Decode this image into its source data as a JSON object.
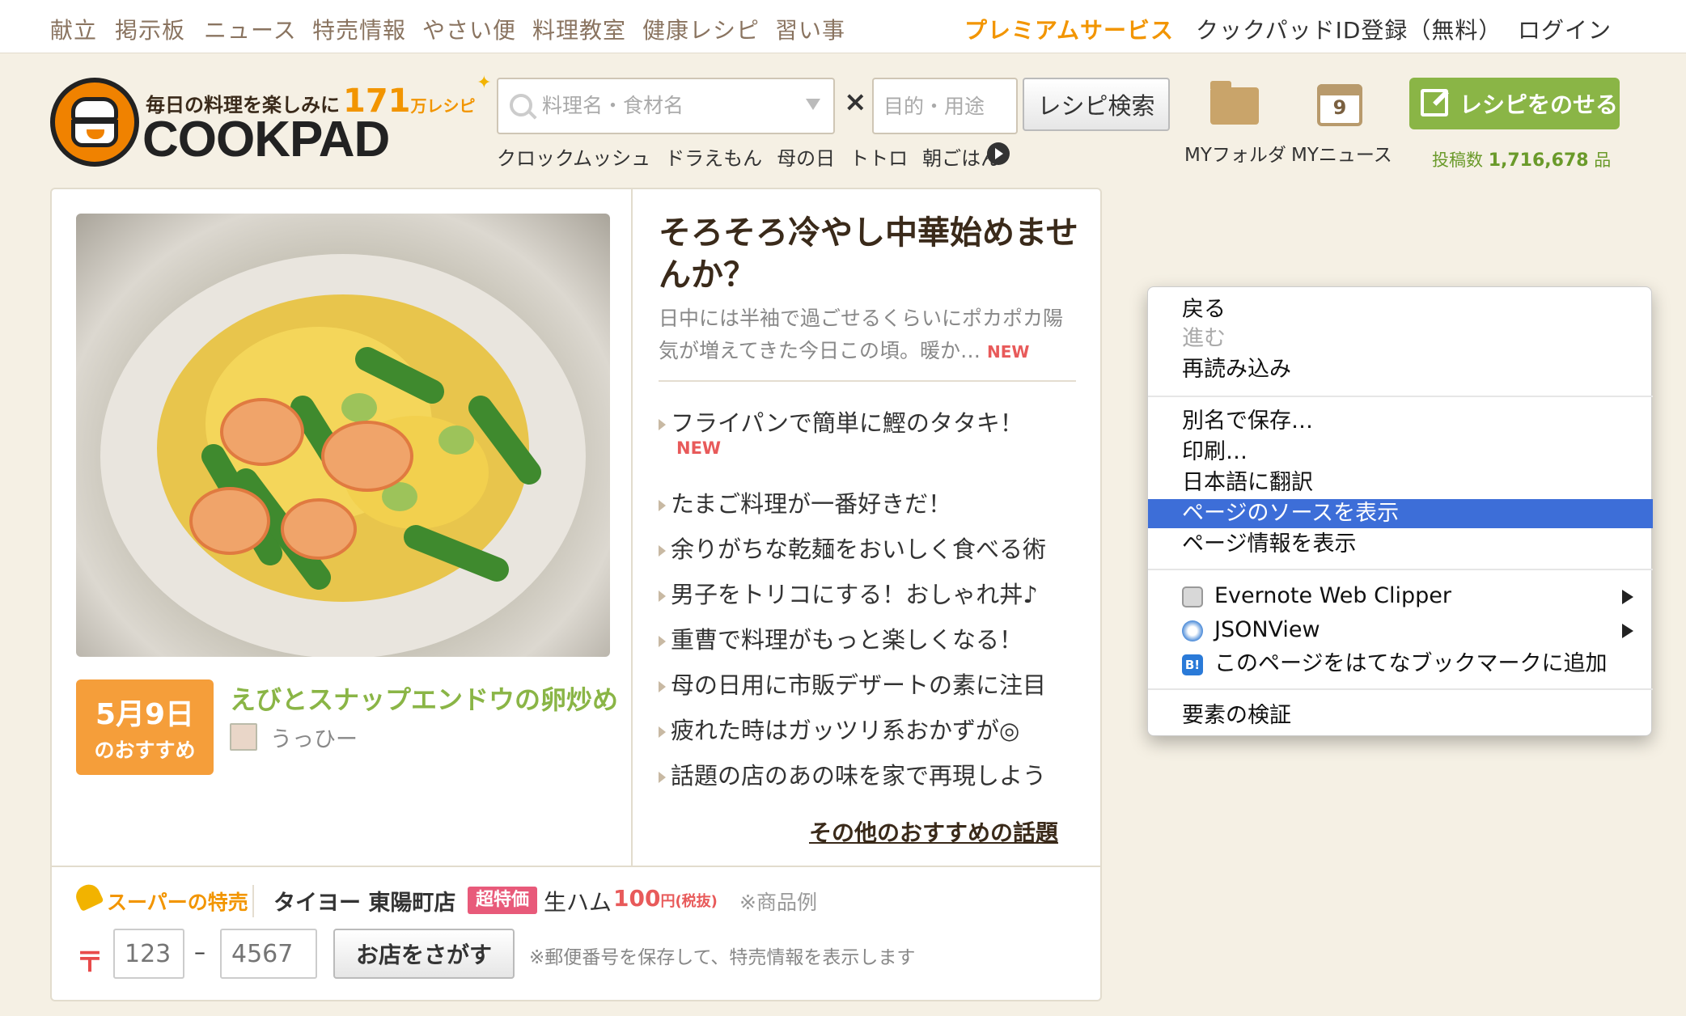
{
  "topnav": {
    "items": [
      "献立",
      "掲示板",
      "ニュース",
      "特売情報",
      "やさい便",
      "料理教室",
      "健康レシピ",
      "習い事"
    ],
    "premium": "プレミアムサービス",
    "register": "クックパッドID登録（無料）",
    "login": "ログイン"
  },
  "logo": {
    "tagline": "毎日の料理を楽しみに",
    "count": "171",
    "unit": "万レシピ",
    "wordmark": "COOKPAD"
  },
  "search": {
    "keyword_placeholder": "料理名・食材名",
    "purpose_placeholder": "目的・用途",
    "button": "レシピ検索",
    "suggestions": [
      "クロックムッシュ",
      "ドラえもん",
      "母の日",
      "トトロ",
      "朝ごはん"
    ]
  },
  "header_icons": {
    "folder_label": "MYフォルダ",
    "news_label": "MYニュース",
    "calendar_day": "9"
  },
  "post": {
    "button": "レシピをのせる",
    "count_prefix": "投稿数",
    "count_value": "1,716,678",
    "count_unit": "品"
  },
  "featured_recipe": {
    "date_line1": "5月9日",
    "date_line2": "のおすすめ",
    "title": "えびとスナップエンドウの卵炒め",
    "author": "うっひー"
  },
  "feature": {
    "title": "そろそろ冷やし中華始めませんか？",
    "description": "日中には半袖で過ごせるくらいにポカポカ陽気が増えてきた今日この頃。暖か…",
    "new_tag": "NEW"
  },
  "topics": [
    {
      "label": "フライパンで簡単に鰹のタタキ！",
      "new": "NEW"
    },
    {
      "label": "たまご料理が一番好きだ！"
    },
    {
      "label": "余りがちな乾麺をおいしく食べる術"
    },
    {
      "label": "男子をトリコにする！おしゃれ丼♪"
    },
    {
      "label": "重曹で料理がもっと楽しくなる！"
    },
    {
      "label": "母の日用に市販デザートの素に注目"
    },
    {
      "label": "疲れた時はガッツリ系おかずが◎"
    },
    {
      "label": "話題の店のあの味を家で再現しよう"
    }
  ],
  "more_topics": "その他のおすすめの話題",
  "sale": {
    "label": "スーパーの特売",
    "store": "タイヨー 東陽町店",
    "badge": "超特価",
    "item": "生ハム",
    "price": "100",
    "price_unit": "円(税抜)",
    "note": "※商品例",
    "postal_mark": "〒",
    "zip1_placeholder": "123",
    "zip_dash": "–",
    "zip2_placeholder": "4567",
    "find_button": "お店をさがす",
    "zip_note": "※郵便番号を保存して、特売情報を表示します"
  },
  "context_menu": {
    "back": "戻る",
    "forward": "進む",
    "reload": "再読み込み",
    "save_as": "別名で保存…",
    "print": "印刷…",
    "translate": "日本語に翻訳",
    "view_source": "ページのソースを表示",
    "page_info": "ページ情報を表示",
    "evernote": "Evernote Web Clipper",
    "jsonview": "JSONView",
    "hatena": "このページをはてなブックマークに追加",
    "hatena_icon_text": "B!",
    "inspect": "要素の検証",
    "selected_color": "#3d6ed8"
  },
  "colors": {
    "accent_orange": "#f29500",
    "accent_green": "#8ab546",
    "new_red": "#e85a5a",
    "page_bg": "#f5f0e4"
  }
}
